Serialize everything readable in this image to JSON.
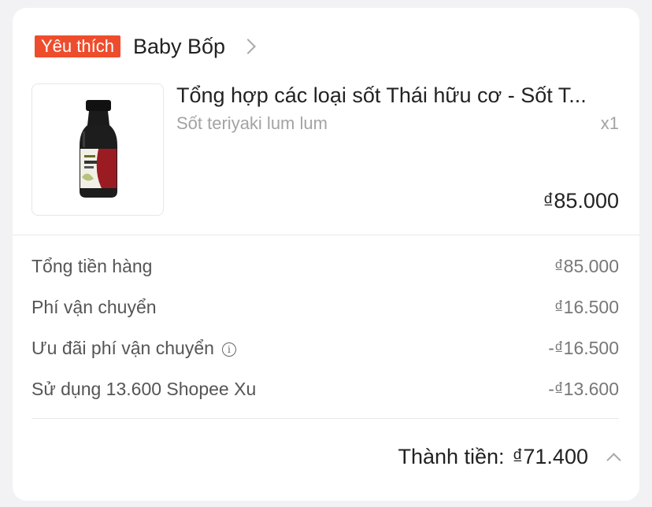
{
  "shop": {
    "badge": "Yêu thích",
    "name": "Baby Bốp"
  },
  "product": {
    "title": "Tổng hợp các loại sốt Thái hữu cơ - Sốt T...",
    "variant": "Sốt teriyaki lum lum",
    "quantity": "x1",
    "price": "₫85.000",
    "image_label": "Organic TERIYAKI Sauce"
  },
  "summary": {
    "rows": [
      {
        "label": "Tổng tiền hàng",
        "value": "₫85.000"
      },
      {
        "label": "Phí vận chuyển",
        "value": "₫16.500"
      },
      {
        "label": "Ưu đãi phí vận chuyển",
        "value": "-₫16.500"
      },
      {
        "label": "Sử dụng 13.600 Shopee Xu",
        "value": "-₫13.600"
      }
    ]
  },
  "total": {
    "label": "Thành tiền:",
    "value": "₫71.400"
  },
  "colors": {
    "accent": "#ee4d2d",
    "text": "#222222",
    "muted": "#a3a3a3"
  }
}
